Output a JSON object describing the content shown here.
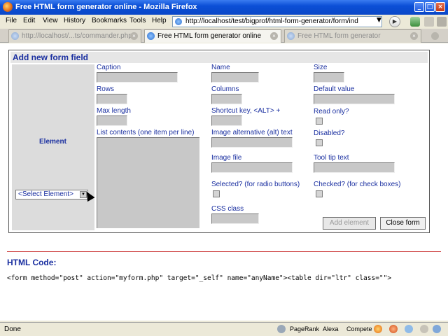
{
  "window": {
    "title": "Free HTML form generator online - Mozilla Firefox"
  },
  "menus": [
    "File",
    "Edit",
    "View",
    "History",
    "Bookmarks",
    "Tools",
    "Help"
  ],
  "url": "http://localhost/test/bigprof/html-form-generator/form/ind",
  "tabs": [
    {
      "label": "http://localhost/...ts/commander.php",
      "active": false
    },
    {
      "label": "Free HTML form generator online",
      "active": true
    },
    {
      "label": "Free HTML form generator",
      "active": false
    }
  ],
  "form": {
    "heading": "Add new form field",
    "element_label": "Element",
    "element_select_value": "<Select Element>",
    "labels": {
      "caption": "Caption",
      "rows": "Rows",
      "max_length": "Max length",
      "list_contents": "List contents (one item per line)",
      "name": "Name",
      "columns": "Columns",
      "shortcut": "Shortcut key, <ALT> +",
      "alt_text": "Image alternative (alt) text",
      "image_file": "Image file",
      "selected": "Selected? (for radio buttons)",
      "css_class": "CSS class",
      "size": "Size",
      "default_value": "Default value",
      "read_only": "Read only?",
      "disabled": "Disabled?",
      "tooltip": "Tool tip text",
      "checked": "Checked? (for check boxes)"
    },
    "buttons": {
      "add": "Add element",
      "close": "Close form"
    }
  },
  "html_code": {
    "title": "HTML Code:",
    "code": "<form method=\"post\" action=\"myform.php\" target=\"_self\" name=\"anyName\"><table dir=\"ltr\" class=\"\">"
  },
  "status": {
    "text": "Done",
    "pagerank": "PageRank",
    "alexa": "Alexa",
    "compete": "Compete"
  }
}
